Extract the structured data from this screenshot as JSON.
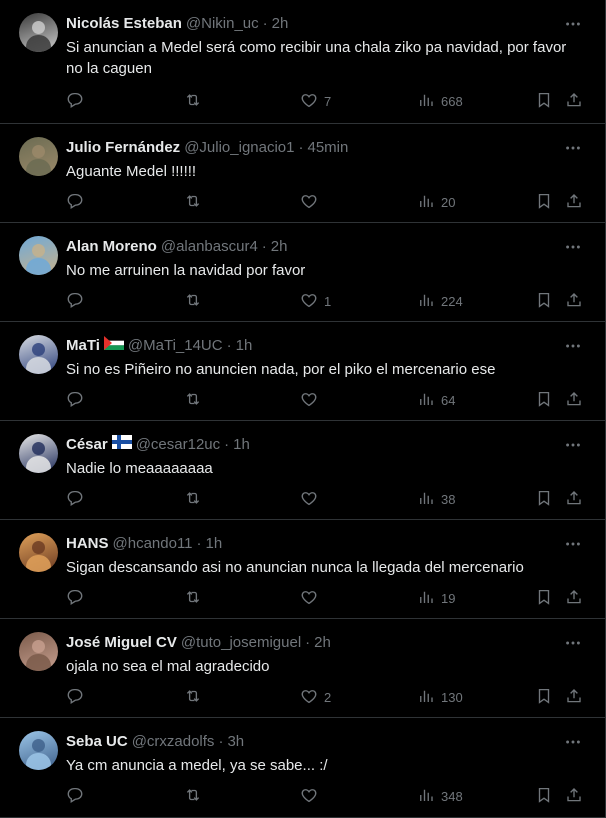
{
  "tweets": [
    {
      "name": "Nicolás Esteban",
      "flag": "",
      "handle": "@Nikin_uc",
      "time": "2h",
      "text": "Si anuncian a Medel será como recibir una chala ziko pa navidad, por favor no la caguen",
      "replies": "",
      "retweets": "",
      "likes": "7",
      "views": "668",
      "avatar_colors": [
        "#3a3a3a",
        "#cfcfcf"
      ]
    },
    {
      "name": "Julio Fernández",
      "flag": "",
      "handle": "@Julio_ignacio1",
      "time": "45min",
      "text": "Aguante Medel !!!!!!",
      "replies": "",
      "retweets": "",
      "likes": "",
      "views": "20",
      "avatar_colors": [
        "#6b6b52",
        "#9c8a6a"
      ]
    },
    {
      "name": "Alan Moreno",
      "flag": "",
      "handle": "@alanbascur4",
      "time": "2h",
      "text": "No me arruinen la navidad por favor",
      "replies": "",
      "retweets": "",
      "likes": "1",
      "views": "224",
      "avatar_colors": [
        "#6fa9d8",
        "#c8b28a"
      ]
    },
    {
      "name": "MaTi",
      "flag": "palestine",
      "handle": "@MaTi_14UC",
      "time": "1h",
      "text": "Si no es Piñeiro no anuncien nada, por el piko el mercenario ese",
      "replies": "",
      "retweets": "",
      "likes": "",
      "views": "64",
      "avatar_colors": [
        "#d9dde3",
        "#2b3f7a"
      ]
    },
    {
      "name": "César",
      "flag": "finland",
      "handle": "@cesar12uc",
      "time": "1h",
      "text": "Nadie lo meaaaaaaaa",
      "replies": "",
      "retweets": "",
      "likes": "",
      "views": "38",
      "avatar_colors": [
        "#e9e9e9",
        "#1f2c5a"
      ]
    },
    {
      "name": "HANS",
      "flag": "",
      "handle": "@hcando11",
      "time": "1h",
      "text": "Sigan descansando asi no anuncian nunca la llegada del mercenario",
      "replies": "",
      "retweets": "",
      "likes": "",
      "views": "19",
      "avatar_colors": [
        "#e0a15a",
        "#6a3a22"
      ]
    },
    {
      "name": "José Miguel CV",
      "flag": "",
      "handle": "@tuto_josemiguel",
      "time": "2h",
      "text": "ojala no sea el mal agradecido",
      "replies": "",
      "retweets": "",
      "likes": "2",
      "views": "130",
      "avatar_colors": [
        "#7a5a4a",
        "#c8a090"
      ]
    },
    {
      "name": "Seba UC",
      "flag": "",
      "handle": "@crxzadolfs",
      "time": "3h",
      "text": "Ya cm anuncia a medel, ya se sabe... :/",
      "replies": "",
      "retweets": "",
      "likes": "",
      "views": "348",
      "avatar_colors": [
        "#9cc6e8",
        "#3d5f8a"
      ]
    }
  ],
  "icons": {
    "more": "more-dots-icon",
    "reply": "reply-icon",
    "retweet": "retweet-icon",
    "like": "heart-icon",
    "views": "views-bar-chart-icon",
    "bookmark": "bookmark-icon",
    "share": "share-icon"
  },
  "colors": {
    "background": "#000000",
    "text": "#e7e9ea",
    "muted": "#71767b",
    "divider": "#2f3336"
  }
}
